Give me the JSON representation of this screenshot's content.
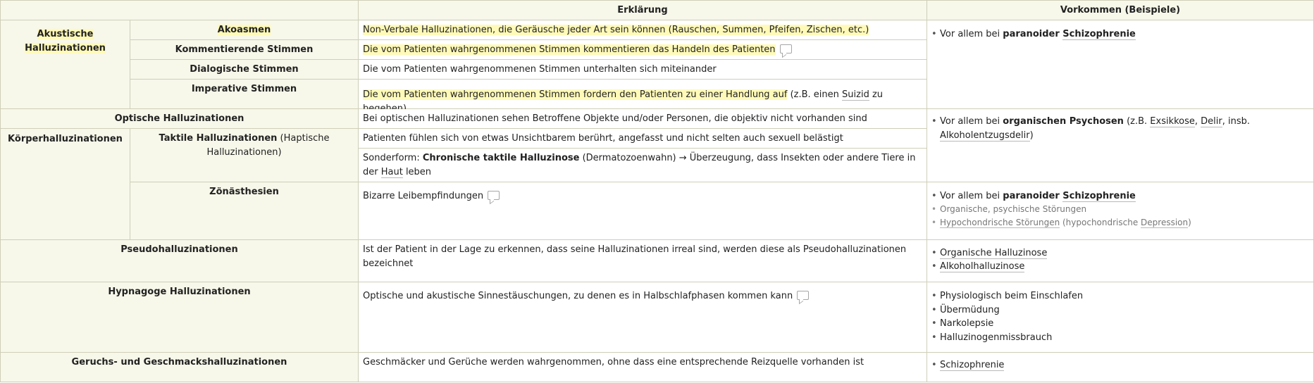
{
  "header": {
    "erklaerung": "Erklärung",
    "vorkommen": "Vorkommen (Beispiele)"
  },
  "akustisch": {
    "group": "Akustische Halluzinationen",
    "akoasmen": {
      "label": "Akoasmen",
      "text_hl": "Non-Verbale Halluzinationen",
      "text_rest": ", die Geräusche jeder Art sein können (Rauschen, Summen, Pfeifen, Zischen, etc.)"
    },
    "kommentierend": {
      "label": "Kommentierende Stimmen",
      "text": "Die vom Patienten wahrgenommenen Stimmen kommentieren das Handeln des Patienten"
    },
    "dialogisch": {
      "label": "Dialogische Stimmen",
      "text": "Die vom Patienten wahrgenommenen Stimmen unterhalten sich miteinander"
    },
    "imperativ": {
      "label": "Imperative Stimmen",
      "text_hl": "Die vom Patienten wahrgenommenen Stimmen fordern den Patienten zu einer Handlung auf",
      "text_a": " (z.B. einen ",
      "text_term": "Suizid",
      "text_b": " zu begehen)"
    },
    "vorkommen": {
      "prefix": "Vor allem bei ",
      "bold": "paranoider ",
      "term": "Schizophrenie"
    }
  },
  "optisch": {
    "label": "Optische Halluzinationen",
    "text": "Bei optischen Halluzinationen sehen Betroffene Objekte und/oder Personen, die objektiv nicht vorhanden sind"
  },
  "organisch_vorkommen": {
    "prefix": "Vor allem bei ",
    "bold": "organischen Psychosen",
    "a": " (z.B. ",
    "t1": "Exsikkose",
    "sep1": ", ",
    "t2": "Delir",
    "b": ", insb. ",
    "t3": "Alkoholentzugsdelir",
    "c": ")"
  },
  "koerper": {
    "group": "Körperhalluzinationen",
    "taktil": {
      "label_bold": "Taktile Halluzinationen",
      "label_plain": " (Haptische Halluzinationen)",
      "text": "Patienten fühlen sich von etwas Unsichtbarem berührt, angefasst und nicht selten auch sexuell belästigt",
      "sf_prefix": "Sonderform: ",
      "sf_bold": "Chronische taktile Halluzinose",
      "sf_rest": " (Dermatozoenwahn) → Überzeugung, dass Insekten oder andere Tiere in der ",
      "sf_term": "Haut",
      "sf_end": " leben"
    },
    "zoenaesthesien": {
      "label": "Zönästhesien",
      "text": "Bizarre Leibempfindungen",
      "v1_prefix": "Vor allem bei ",
      "v1_bold": "paranoider ",
      "v1_term": "Schizophrenie",
      "v2": "Organische, psychische Störungen",
      "v3_term": "Hypochondrische Störungen",
      "v3_a": " (hypochondrische ",
      "v3_term2": "Depression",
      "v3_b": ")"
    }
  },
  "pseudo": {
    "label": "Pseudohalluzinationen",
    "text": "Ist der Patient in der Lage zu erkennen, dass seine Halluzinationen irreal sind, werden diese als Pseudohalluzinationen bezeichnet",
    "items": [
      "Organische Halluzinose",
      "Alkoholhalluzinose"
    ]
  },
  "hypnagog": {
    "label": "Hypnagoge Halluzinationen",
    "text": "Optische und akustische Sinnestäuschungen, zu denen es in Halbschlafphasen kommen kann",
    "items": [
      "Physiologisch beim Einschlafen",
      "Übermüdung",
      "Narkolepsie",
      "Halluzinogenmissbrauch"
    ]
  },
  "geruch": {
    "label": "Geruchs- und Geschmackshalluzinationen",
    "text": "Geschmäcker und Gerüche werden wahrgenommen, ohne dass eine entsprechende Reizquelle vorhanden ist",
    "item": "Schizophrenie"
  }
}
